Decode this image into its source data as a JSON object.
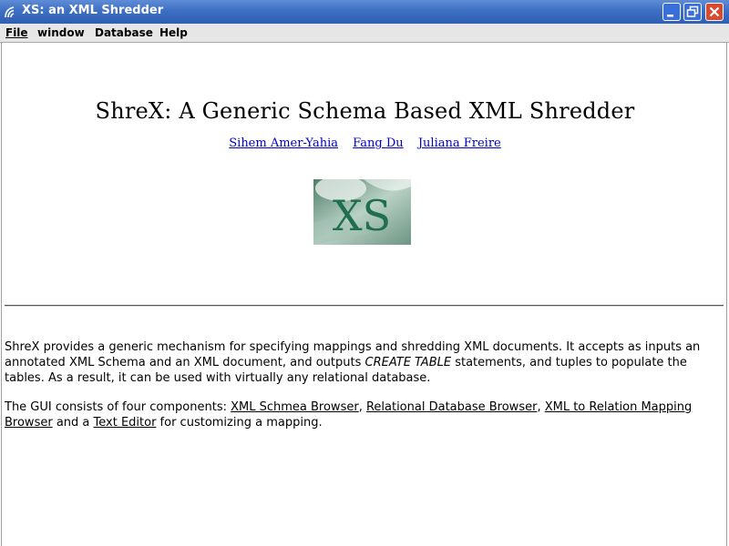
{
  "window": {
    "title": "XS: an XML Shredder",
    "title_icon": "java-wave-icon",
    "buttons": {
      "minimize": "minimize-icon",
      "restore": "restore-icon",
      "close": "close-icon"
    },
    "colors": {
      "titlebar": "#3d6fc4",
      "close": "#d9492e",
      "link": "#0000cc"
    }
  },
  "menubar": {
    "file": "File",
    "window": "window",
    "database": "Database",
    "help": "Help"
  },
  "document": {
    "title": "ShreX: A Generic Schema Based XML Shredder",
    "authors": [
      "Sihem Amer-Yahia",
      "Fang Du",
      "Juliana Freire"
    ],
    "logo_text": "XS",
    "p1_text_a": "ShreX provides a generic mechanism for specifying mappings and shredding XML documents. It accepts as inputs an annotated XML Schema and an XML document, and outputs ",
    "p1_emph": "CREATE TABLE",
    "p1_text_b": " statements, and tuples to populate the tables. As a result, it can be used with virtually any relational database.",
    "p2_text_a": "The GUI consists of four components: ",
    "p2_link1": "XML Schmea Browser",
    "p2_sep1": ", ",
    "p2_link2": "Relational Database Browser",
    "p2_sep2": ", ",
    "p2_link3": "XML to Relation Mapping Browser",
    "p2_text_b": " and a ",
    "p2_link4": "Text Editor",
    "p2_text_c": " for customizing a mapping."
  }
}
